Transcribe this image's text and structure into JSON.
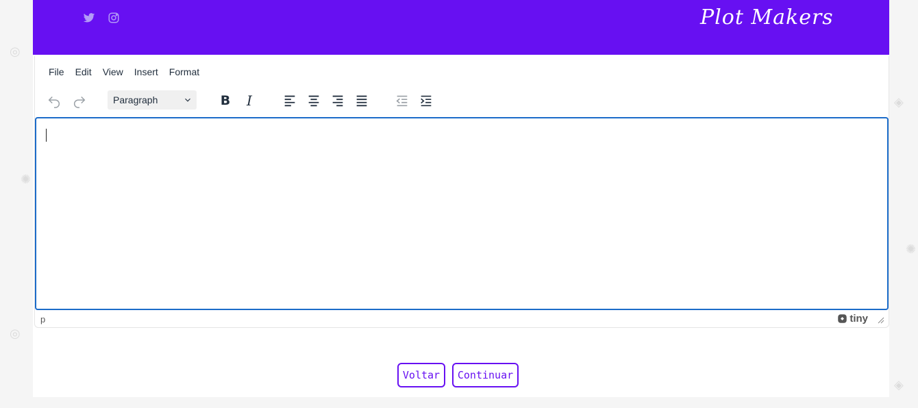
{
  "header": {
    "social": [
      {
        "name": "twitter-icon"
      },
      {
        "name": "instagram-icon"
      }
    ],
    "logo_text": "Plot Makers",
    "accent_color": "#6710f2"
  },
  "editor": {
    "menu": [
      "File",
      "Edit",
      "View",
      "Insert",
      "Format"
    ],
    "block_format": "Paragraph",
    "status_path": "p",
    "brand": "tiny"
  },
  "actions": {
    "back_label": "Voltar",
    "continue_label": "Continuar"
  }
}
